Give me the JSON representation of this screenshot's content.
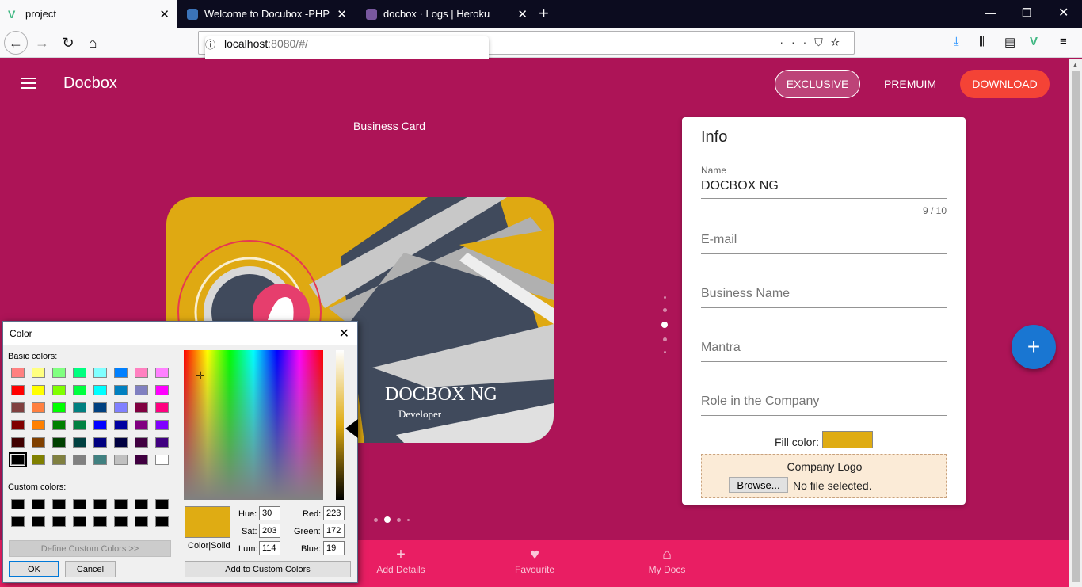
{
  "browser": {
    "tabs": [
      {
        "label": "project",
        "active": true
      },
      {
        "label": "Welcome to Docubox -PHP",
        "active": false
      },
      {
        "label": "docbox · Logs | Heroku",
        "active": false
      }
    ],
    "url_host": "localhost",
    "url_rest": ":8080/#/"
  },
  "app": {
    "brand": "Docbox",
    "nav": {
      "exclusive": "EXCLUSIVE",
      "premium": "PREMUIM",
      "download": "DOWNLOAD"
    },
    "section_title": "Business Card",
    "card": {
      "name": "DOCBOX NG",
      "role": "Developer",
      "fill_color": "#dfac13"
    },
    "info": {
      "title": "Info",
      "name_label": "Name",
      "name_value": "DOCBOX NG",
      "counter": "9 / 10",
      "email_placeholder": "E-mail",
      "business_placeholder": "Business Name",
      "mantra_placeholder": "Mantra",
      "role_placeholder": "Role in the Company",
      "fill_label": "Fill color:",
      "logo_label": "Company Logo",
      "browse_label": "Browse...",
      "no_file": "No file selected."
    },
    "fab": "+",
    "bottom_nav": [
      {
        "label": "Add Details",
        "icon": "plus-icon"
      },
      {
        "label": "Favourite",
        "icon": "heart-icon"
      },
      {
        "label": "My Docs",
        "icon": "home-icon"
      }
    ],
    "colors": {
      "primary": "#ad1457",
      "bottom": "#e91e63",
      "accent": "#f44336",
      "fab": "#1976d2"
    }
  },
  "color_dialog": {
    "title": "Color",
    "basic_label": "Basic colors:",
    "custom_label": "Custom colors:",
    "define_btn": "Define Custom Colors >>",
    "ok": "OK",
    "cancel": "Cancel",
    "add_btn": "Add to Custom Colors",
    "color_solid_label": "Color|Solid",
    "hue_label": "Hue:",
    "sat_label": "Sat:",
    "lum_label": "Lum:",
    "red_label": "Red:",
    "green_label": "Green:",
    "blue_label": "Blue:",
    "hue": "30",
    "sat": "203",
    "lum": "114",
    "red": "223",
    "green": "172",
    "blue": "19",
    "basic_colors": [
      [
        "#ff8080",
        "#ffff80",
        "#80ff80",
        "#00ff80",
        "#80ffff",
        "#0080ff",
        "#ff80c0",
        "#ff80ff"
      ],
      [
        "#ff0000",
        "#ffff00",
        "#80ff00",
        "#00ff40",
        "#00ffff",
        "#0080c0",
        "#8080c0",
        "#ff00ff"
      ],
      [
        "#804040",
        "#ff8040",
        "#00ff00",
        "#008080",
        "#004080",
        "#8080ff",
        "#800040",
        "#ff0080"
      ],
      [
        "#800000",
        "#ff8000",
        "#008000",
        "#008040",
        "#0000ff",
        "#0000a0",
        "#800080",
        "#8000ff"
      ],
      [
        "#400000",
        "#804000",
        "#004000",
        "#004040",
        "#000080",
        "#000040",
        "#400040",
        "#400080"
      ],
      [
        "#000000",
        "#808000",
        "#808040",
        "#808080",
        "#408080",
        "#c0c0c0",
        "#400040",
        "#ffffff"
      ]
    ]
  }
}
